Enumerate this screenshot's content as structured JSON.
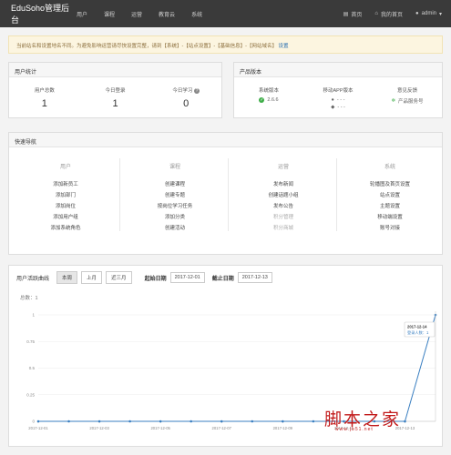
{
  "topbar": {
    "brand": "EduSoho管理后台",
    "nav": [
      "用户",
      "课程",
      "运营",
      "教育云",
      "系统"
    ],
    "right": {
      "home": "首页",
      "my_home": "我的首页",
      "user": "admin"
    }
  },
  "notice": {
    "text": "当前站名和设置地名不同。为避免影响运营请尽快设置完整，请到【系统】-【站点设置】-【基础信息】-【网站域名】",
    "link": "设置"
  },
  "user_stats": {
    "title": "用户统计",
    "items": [
      {
        "label": "用户总数",
        "value": "1"
      },
      {
        "label": "今日登录",
        "value": "1"
      },
      {
        "label": "今日学习",
        "value": "0"
      }
    ]
  },
  "product": {
    "title": "产品版本",
    "system_label": "系统版本",
    "system_value": "2.6.6",
    "app_label": "移动APP版本",
    "app_ios": "- - -",
    "app_android": "- - -",
    "feedback_label": "意见反馈",
    "feedback_value": "产品服务号"
  },
  "quick_nav": {
    "title": "快速导航",
    "columns": [
      {
        "heading": "用户",
        "items": [
          "添加新员工",
          "添加部门",
          "添加岗位",
          "添加用户组",
          "添加系统角色"
        ]
      },
      {
        "heading": "课程",
        "items": [
          "创建课程",
          "创建专题",
          "按岗位学习任务",
          "添加分类",
          "创建活动"
        ]
      },
      {
        "heading": "运营",
        "items": [
          "发布新闻",
          "创建话题小组",
          "发布公告",
          "积分管理",
          "积分商城"
        ]
      },
      {
        "heading": "系统",
        "items": [
          "轮播图及首页设置",
          "站点设置",
          "主题设置",
          "移动端设置",
          "账号对接"
        ]
      }
    ]
  },
  "activity": {
    "title": "用户活跃曲线",
    "buttons": [
      "本周",
      "上月",
      "近三月"
    ],
    "start_label": "起始日期",
    "start_value": "2017-12-01",
    "end_label": "截止日期",
    "end_value": "2017-12-13",
    "total_label": "总数：1"
  },
  "chart_data": {
    "type": "line",
    "x": [
      "2017-12-01",
      "2017-12-02",
      "2017-12-03",
      "2017-12-04",
      "2017-12-05",
      "2017-12-06",
      "2017-12-07",
      "2017-12-08",
      "2017-12-09",
      "2017-12-10",
      "2017-12-11",
      "2017-12-12",
      "2017-12-13",
      "2017-12-14"
    ],
    "xticks": [
      "2017-12-01",
      "2017-12-03",
      "2017-12-05",
      "2017-12-07",
      "2017-12-09",
      "2017-12-11",
      "2017-12-13"
    ],
    "values": [
      0,
      0,
      0,
      0,
      0,
      0,
      0,
      0,
      0,
      0,
      0,
      0,
      0,
      1
    ],
    "yticks": [
      "0",
      "0.25",
      "0.5",
      "0.75",
      "1"
    ],
    "ylim": [
      0,
      1
    ],
    "tooltip_date": "2017-12-14",
    "tooltip_value": "登录人数：1",
    "color": "#3a7fc1"
  },
  "watermark": {
    "text": "脚本之家",
    "url": "www.jb51.net"
  }
}
